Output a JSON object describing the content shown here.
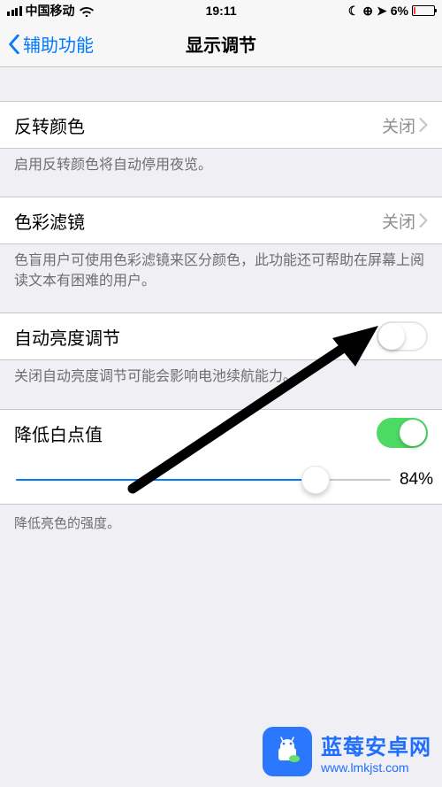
{
  "status": {
    "carrier": "中国移动",
    "time": "19:11",
    "battery_pct": "6%"
  },
  "nav": {
    "back_label": "辅助功能",
    "title": "显示调节"
  },
  "rows": {
    "invert": {
      "label": "反转颜色",
      "value": "关闭"
    },
    "invert_footer": "启用反转颜色将自动停用夜览。",
    "colorfilters": {
      "label": "色彩滤镜",
      "value": "关闭"
    },
    "colorfilters_footer": "色盲用户可使用色彩滤镜来区分颜色，此功能还可帮助在屏幕上阅读文本有困难的用户。",
    "autobrightness": {
      "label": "自动亮度调节"
    },
    "autobrightness_footer": "关闭自动亮度调节可能会影响电池续航能力。",
    "whitepoint": {
      "label": "降低白点值"
    },
    "whitepoint_value": "84%",
    "whitepoint_footer": "降低亮色的强度。"
  },
  "watermark": {
    "name": "蓝莓安卓网",
    "url": "www.lmkjst.com"
  }
}
